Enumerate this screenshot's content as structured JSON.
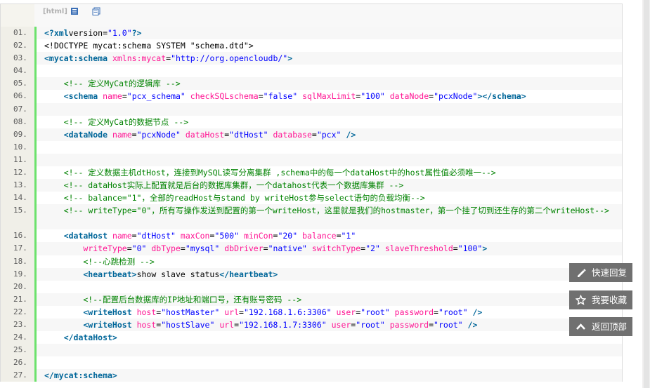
{
  "toolbar": {
    "lang": "[html]",
    "view_icon": "view-source-icon",
    "copy_icon": "copy-icon"
  },
  "code_lines": [
    {
      "n": "01.",
      "tokens": [
        [
          "tag",
          "<?xml"
        ],
        [
          "",
          "version="
        ],
        [
          "sv",
          "\"1.0\""
        ],
        [
          "tag",
          "?>"
        ]
      ]
    },
    {
      "n": "02.",
      "tokens": [
        [
          "",
          "<!DOCTYPE mycat:schema SYSTEM \"schema.dtd\">"
        ]
      ]
    },
    {
      "n": "03.",
      "tokens": [
        [
          "tag",
          "<mycat:schema"
        ],
        [
          "",
          " "
        ],
        [
          "at",
          "xmlns:mycat"
        ],
        [
          "",
          "="
        ],
        [
          "sv",
          "\"http://org.opencloudb/\""
        ],
        [
          "tag",
          ">"
        ]
      ]
    },
    {
      "n": "04.",
      "tokens": []
    },
    {
      "n": "05.",
      "tokens": [
        [
          "cm",
          "    <!-- 定义MyCat的逻辑库 -->"
        ]
      ]
    },
    {
      "n": "06.",
      "tokens": [
        [
          "",
          " "
        ],
        [
          "tag",
          "   <schema"
        ],
        [
          "",
          " "
        ],
        [
          "at",
          "name"
        ],
        [
          "",
          "="
        ],
        [
          "sv",
          "\"pcx_schema\""
        ],
        [
          "",
          " "
        ],
        [
          "at",
          "checkSQLschema"
        ],
        [
          "",
          "="
        ],
        [
          "sv",
          "\"false\""
        ],
        [
          "",
          " "
        ],
        [
          "at",
          "sqlMaxLimit"
        ],
        [
          "",
          "="
        ],
        [
          "sv",
          "\"100\""
        ],
        [
          "",
          " "
        ],
        [
          "at",
          "dataNode"
        ],
        [
          "",
          "="
        ],
        [
          "sv",
          "\"pcxNode\""
        ],
        [
          "tag",
          "></schema>"
        ]
      ]
    },
    {
      "n": "07.",
      "tokens": []
    },
    {
      "n": "08.",
      "tokens": [
        [
          "cm",
          "    <!-- 定义MyCat的数据节点 -->"
        ]
      ]
    },
    {
      "n": "09.",
      "tokens": [
        [
          "tag",
          "    <dataNode"
        ],
        [
          "",
          " "
        ],
        [
          "at",
          "name"
        ],
        [
          "",
          "="
        ],
        [
          "sv",
          "\"pcxNode\""
        ],
        [
          "",
          " "
        ],
        [
          "at",
          "dataHost"
        ],
        [
          "",
          "="
        ],
        [
          "sv",
          "\"dtHost\""
        ],
        [
          "",
          " "
        ],
        [
          "at",
          "database"
        ],
        [
          "",
          "="
        ],
        [
          "sv",
          "\"pcx\""
        ],
        [
          "",
          " "
        ],
        [
          "tag",
          "/>"
        ]
      ]
    },
    {
      "n": "10.",
      "tokens": []
    },
    {
      "n": "11.",
      "tokens": []
    },
    {
      "n": "12.",
      "tokens": [
        [
          "cm",
          "    <!-- 定义数据主机dtHost，连接到MySQL读写分离集群 ,schema中的每一个dataHost中的host属性值必须唯一-->"
        ]
      ]
    },
    {
      "n": "13.",
      "tokens": [
        [
          "cm",
          "    <!-- dataHost实际上配置就是后台的数据库集群，一个datahost代表一个数据库集群 -->"
        ]
      ]
    },
    {
      "n": "14.",
      "tokens": [
        [
          "cm",
          "    <!-- balance=\"1\"，全部的readHost与stand by writeHost参与select语句的负载均衡-->"
        ]
      ]
    },
    {
      "n": "15.",
      "tall": true,
      "tokens": [
        [
          "cm",
          "    <!-- writeType=\"0\"，所有写操作发送到配置的第一个writeHost，这里就是我们的hostmaster，第一个挂了切到还生存的第二个writeHost-->"
        ]
      ]
    },
    {
      "n": "16.",
      "tokens": [
        [
          "tag",
          "    <dataHost"
        ],
        [
          "",
          " "
        ],
        [
          "at",
          "name"
        ],
        [
          "",
          "="
        ],
        [
          "sv",
          "\"dtHost\""
        ],
        [
          "",
          " "
        ],
        [
          "at",
          "maxCon"
        ],
        [
          "",
          "="
        ],
        [
          "sv",
          "\"500\""
        ],
        [
          "",
          " "
        ],
        [
          "at",
          "minCon"
        ],
        [
          "",
          "="
        ],
        [
          "sv",
          "\"20\""
        ],
        [
          "",
          " "
        ],
        [
          "at",
          "balance"
        ],
        [
          "",
          "="
        ],
        [
          "sv",
          "\"1\""
        ]
      ]
    },
    {
      "n": "17.",
      "tokens": [
        [
          "",
          "        "
        ],
        [
          "at",
          "writeType"
        ],
        [
          "",
          "="
        ],
        [
          "sv",
          "\"0\""
        ],
        [
          "",
          " "
        ],
        [
          "at",
          "dbType"
        ],
        [
          "",
          "="
        ],
        [
          "sv",
          "\"mysql\""
        ],
        [
          "",
          " "
        ],
        [
          "at",
          "dbDriver"
        ],
        [
          "",
          "="
        ],
        [
          "sv",
          "\"native\""
        ],
        [
          "",
          " "
        ],
        [
          "at",
          "switchType"
        ],
        [
          "",
          "="
        ],
        [
          "sv",
          "\"2\""
        ],
        [
          "",
          " "
        ],
        [
          "at",
          "slaveThreshold"
        ],
        [
          "",
          "="
        ],
        [
          "sv",
          "\"100\""
        ],
        [
          "tag",
          ">"
        ]
      ]
    },
    {
      "n": "18.",
      "tokens": [
        [
          "cm",
          "        <!--心跳检测 -->"
        ]
      ]
    },
    {
      "n": "19.",
      "tokens": [
        [
          "tag",
          "        <heartbeat>"
        ],
        [
          "",
          "show slave status"
        ],
        [
          "tag",
          "</heartbeat>"
        ]
      ]
    },
    {
      "n": "20.",
      "tokens": []
    },
    {
      "n": "21.",
      "tokens": [
        [
          "cm",
          "        <!--配置后台数据库的IP地址和端口号，还有账号密码 -->"
        ]
      ]
    },
    {
      "n": "22.",
      "tokens": [
        [
          "tag",
          "        <writeHost"
        ],
        [
          "",
          " "
        ],
        [
          "at",
          "host"
        ],
        [
          "",
          "="
        ],
        [
          "sv",
          "\"hostMaster\""
        ],
        [
          "",
          " "
        ],
        [
          "at",
          "url"
        ],
        [
          "",
          "="
        ],
        [
          "sv",
          "\"192.168.1.6:3306\""
        ],
        [
          "",
          " "
        ],
        [
          "at",
          "user"
        ],
        [
          "",
          "="
        ],
        [
          "sv",
          "\"root\""
        ],
        [
          "",
          " "
        ],
        [
          "at",
          "password"
        ],
        [
          "",
          "="
        ],
        [
          "sv",
          "\"root\""
        ],
        [
          "",
          " "
        ],
        [
          "tag",
          "/>"
        ]
      ]
    },
    {
      "n": "23.",
      "tokens": [
        [
          "tag",
          "        <writeHost"
        ],
        [
          "",
          " "
        ],
        [
          "at",
          "host"
        ],
        [
          "",
          "="
        ],
        [
          "sv",
          "\"hostSlave\""
        ],
        [
          "",
          " "
        ],
        [
          "at",
          "url"
        ],
        [
          "",
          "="
        ],
        [
          "sv",
          "\"192.168.1.7:3306\""
        ],
        [
          "",
          " "
        ],
        [
          "at",
          "user"
        ],
        [
          "",
          "="
        ],
        [
          "sv",
          "\"root\""
        ],
        [
          "",
          " "
        ],
        [
          "at",
          "password"
        ],
        [
          "",
          "="
        ],
        [
          "sv",
          "\"root\""
        ],
        [
          "",
          " "
        ],
        [
          "tag",
          "/>"
        ]
      ]
    },
    {
      "n": "24.",
      "tokens": [
        [
          "tag",
          "    </dataHost>"
        ]
      ]
    },
    {
      "n": "25.",
      "tokens": []
    },
    {
      "n": "26.",
      "tokens": []
    },
    {
      "n": "27.",
      "tokens": [
        [
          "tag",
          "</mycat:schema>"
        ]
      ]
    }
  ],
  "float_buttons": [
    {
      "label": "快速回复",
      "icon": "pencil-icon",
      "name": "quick-reply-button"
    },
    {
      "label": "我要收藏",
      "icon": "star-icon",
      "name": "favorite-button"
    },
    {
      "label": "返回顶部",
      "icon": "chevron-up-icon",
      "name": "back-to-top-button"
    }
  ],
  "colors": {
    "tag": "#006699",
    "attr": "#ff1493",
    "string": "#0000ff",
    "comment": "#008200",
    "gutter_bar": "#6ce26c",
    "float_bg": "#707070"
  }
}
